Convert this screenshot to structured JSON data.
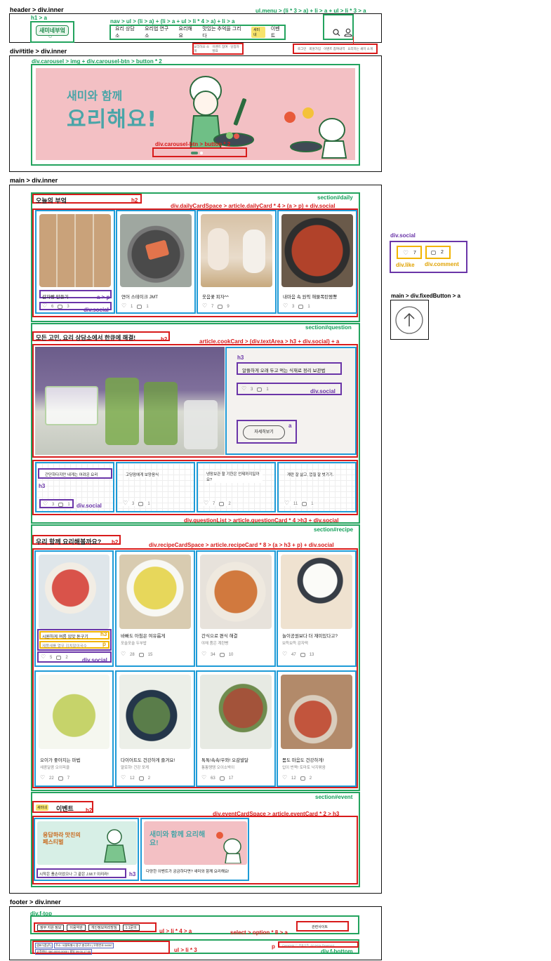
{
  "labels": {
    "header": "header > div.inner",
    "h1a": "h1 > a",
    "nav": "nav > ul > (li > a) + (li > a + ul > li * 4 > a) + li > a",
    "umenu": "ul.menu > (li * 3 > a) + li > a + ul > li * 3 > a",
    "title": "div#title > div.inner",
    "carousel": "div.carousel > img + div.carousel-btn > button * 2",
    "carouselBtn": "div.carousel-btn > button * 2",
    "main": "main > div.inner",
    "sectionDaily": "section#daily",
    "h2": "h2",
    "dailySpace": "div.dailyCardSpace > article.dailyCard * 4 > (a > p) + div.social",
    "ap": "a > p",
    "divSocial": "div.social",
    "sectionQuestion": "section#question",
    "cookCard": "article.cookCard > (div.textArea > h3 + div.social) + a",
    "h3": "h3",
    "a": "a",
    "questionList": "div.questionList > article.questionCard * 4 >h3 + div.social",
    "sectionRecipe": "section#recipe",
    "recipeSpace": "div.recipeCardSpace > article.recipeCard * 8 > (a > h3 + p) + div.social",
    "p": "p",
    "sectionEvent": "section#event",
    "eventSpace": "div.eventCardSpace > article.eventCard * 2 > h3",
    "footer": "footer > div.inner",
    "ftop": "div.f-top",
    "ulli4": "ul > li * 4 > a",
    "select": "select > option * 8 > a",
    "ulli3": "ul > li * 3",
    "fbottom": "div.f-bottom",
    "sideSocial": "div.social",
    "divLike": "div.like",
    "divComment": "div.comment",
    "fixedBtn": "main > div.fixedButton > a"
  },
  "header": {
    "logo": "새미네부엌",
    "nav": [
      "요리 상담소",
      "요리법 연구소",
      "요리해요",
      "맛있는 추억을 그리다",
      "이벤트"
    ],
    "subnav": [
      "요리하요·소개",
      "이벤트 참여 · 당첨자 발표",
      "요리하요 공유"
    ],
    "menu": [
      "로그인",
      "회원가입",
      "이벤트 참여내역",
      "요리하는 새미 소개"
    ],
    "event_badge": "새미네"
  },
  "carousel": {
    "line1": "새미와 함께",
    "line2": "요리해요!"
  },
  "daily": {
    "title": "오늘의 부엌",
    "cards": [
      {
        "title": "감자빵 만들기",
        "likes": "6",
        "comments": "3"
      },
      {
        "title": "연어 스테이크 JMT",
        "likes": "1",
        "comments": "1"
      },
      {
        "title": "옷음꽃 피자^^",
        "likes": "7",
        "comments": "9"
      },
      {
        "title": "내마음 속 원픽 해물폭탄짬뽕",
        "likes": "3",
        "comments": "1"
      }
    ]
  },
  "question": {
    "title": "모든 고민, 요리 상담소에서 한큐에 해결!",
    "feature": {
      "title": "알뜰하게 오래 두고 먹는 식재료 정리 보관법",
      "likes": "3",
      "comments": "1",
      "button": "자세히보기"
    },
    "cards": [
      {
        "title": "간단하다지만 내게는 어려운 요리",
        "likes": "3",
        "comments": "1"
      },
      {
        "title": "고딩맘에게 보양음식",
        "likes": "3",
        "comments": "1"
      },
      {
        "title": "냉장보관 할 기한은 언제까지일까요?",
        "likes": "7",
        "comments": "2"
      },
      {
        "title": "계란 잘 삶고, 껍질 잘 벗기기.",
        "likes": "11",
        "comments": "1"
      }
    ]
  },
  "recipe": {
    "title": "우리 함께 요리해볼까요?",
    "cards": [
      {
        "title": "시원하게 여름 입맛 돋구기",
        "sub": "제품새를 열무 김치말이국수",
        "likes": "5",
        "comments": "2"
      },
      {
        "title": "바빠도 아침은 여유롭게",
        "sub": "포슬포슬 두부밥",
        "likes": "28",
        "comments": "15"
      },
      {
        "title": "간식으로 편식 해결",
        "sub": "야채 품은 계란빵",
        "likes": "34",
        "comments": "10"
      },
      {
        "title": "놀이공원보다 더 재미있다고?",
        "sub": "보득보득 감자떡",
        "likes": "47",
        "comments": "13"
      },
      {
        "title": "오이가 좋아지는 마법",
        "sub": "새콤달콤 오이피클",
        "likes": "22",
        "comments": "7"
      },
      {
        "title": "다이어트도 건강하게 즐겨요!",
        "sub": "얄로하! 건강 포케",
        "likes": "12",
        "comments": "2"
      },
      {
        "title": "톡톡!속속!우와! 오감발달",
        "sub": "통통탱탱 오이소박이",
        "likes": "63",
        "comments": "17"
      },
      {
        "title": "몸도 마음도 건강하게!",
        "sub": "입이 번쩍! 토마토 낙지볶음",
        "likes": "12",
        "comments": "2"
      }
    ]
  },
  "event": {
    "title": "이벤트",
    "badge": "새미네",
    "cards": [
      {
        "title": "시작은 풍손이었으나 그 끝은 J.M.T 이리라!",
        "banner": "응답하라 맛친의 페스티벌"
      },
      {
        "title": "다양한 이벤트가 궁금하다면? 새미와 함께 요리해요!",
        "banner": "새미와 함께 요리해요!"
      }
    ]
  },
  "footer": {
    "links": [
      "정부 지원 정보",
      "이용약관",
      "개인정보처리방침",
      "1:1문의"
    ],
    "select": "관련사이트",
    "info": [
      "샘표식품(주)",
      "주소: 서울특별시 중구 충무로2 | 우편번호 04557",
      "고객센터: 080-0000-0000 | 평일 09:00-17:00"
    ],
    "copyright": "Copyright ⓒ 샘표식품. All rights Reserved."
  },
  "side": {
    "likes": "7",
    "comments": "2"
  },
  "colors": {
    "green": "#23a35e",
    "red": "#d81b1b",
    "purple": "#6a35a8",
    "blue": "#1e9bd7",
    "yellow": "#f2b400",
    "banner_pink": "#f3c0c4"
  }
}
